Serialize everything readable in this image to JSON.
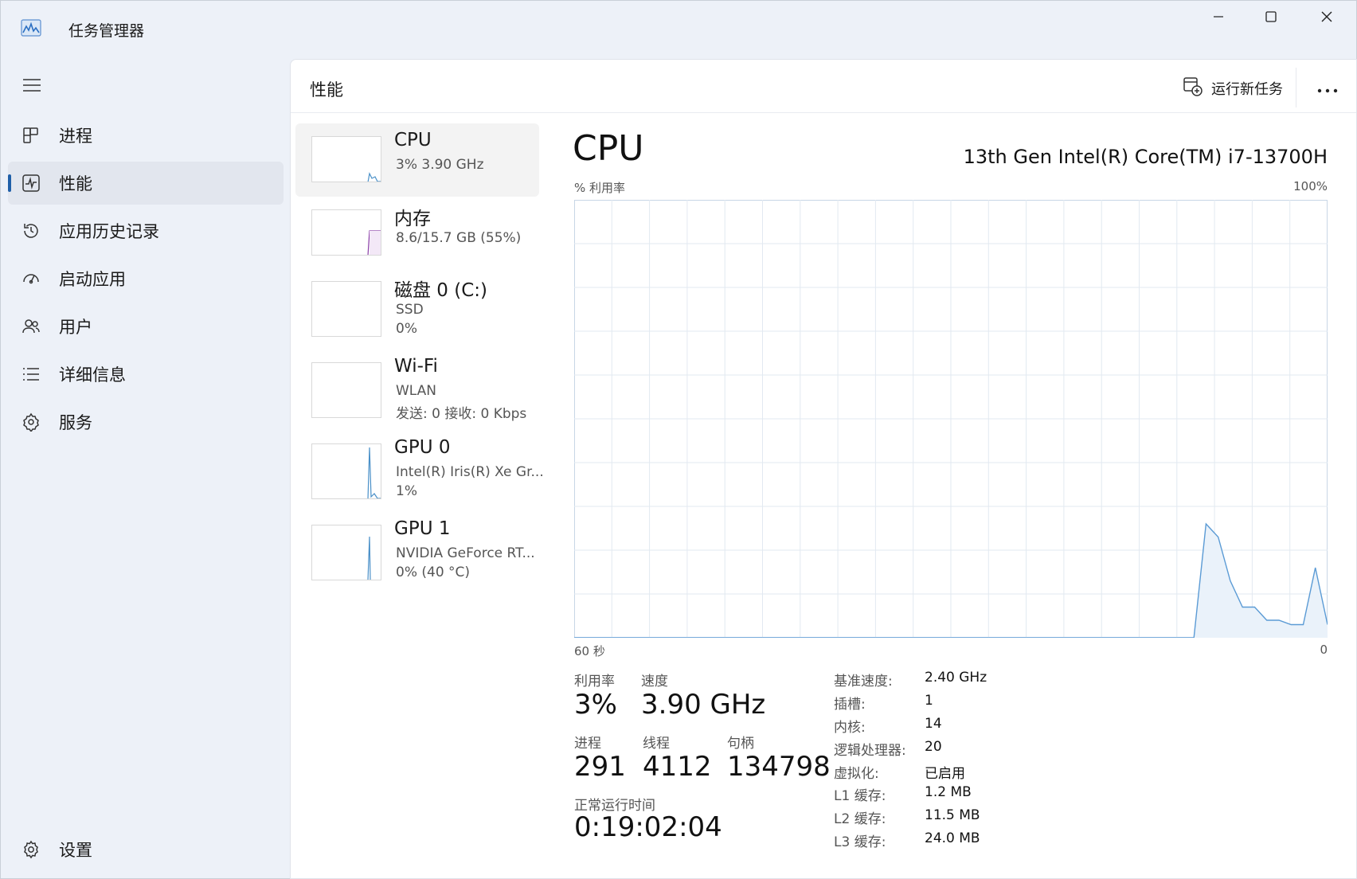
{
  "app": {
    "title": "任务管理器",
    "accent": "#1f5fa8",
    "graph_color": "#5b9bd5"
  },
  "window_controls": {
    "minimize": "minimize-icon",
    "maximize": "maximize-icon",
    "close": "close-icon"
  },
  "nav": {
    "items": [
      {
        "label": "进程",
        "icon": "processes-icon"
      },
      {
        "label": "性能",
        "icon": "performance-icon",
        "active": true
      },
      {
        "label": "应用历史记录",
        "icon": "history-icon"
      },
      {
        "label": "启动应用",
        "icon": "startup-icon"
      },
      {
        "label": "用户",
        "icon": "users-icon"
      },
      {
        "label": "详细信息",
        "icon": "details-icon"
      },
      {
        "label": "服务",
        "icon": "services-icon"
      }
    ],
    "settings_label": "设置"
  },
  "header": {
    "title": "性能",
    "run_task": "运行新任务",
    "more_icon": "more-icon"
  },
  "devices": [
    {
      "title": "CPU",
      "line1": "3%  3.90 GHz",
      "line2": ""
    },
    {
      "title": "内存",
      "line1": "8.6/15.7 GB (55%)",
      "line2": ""
    },
    {
      "title": "磁盘 0 (C:)",
      "line1": "SSD",
      "line2": "0%"
    },
    {
      "title": "Wi-Fi",
      "line1": "WLAN",
      "line2": "发送: 0  接收: 0 Kbps"
    },
    {
      "title": "GPU 0",
      "line1": "Intel(R) Iris(R) Xe Gr...",
      "line2": "1%"
    },
    {
      "title": "GPU 1",
      "line1": "NVIDIA GeForce RT...",
      "line2": "0%  (40 °C)"
    }
  ],
  "detail": {
    "title": "CPU",
    "model": "13th Gen Intel(R) Core(TM) i7-13700H",
    "y_axis_label": "% 利用率",
    "y_max": "100%",
    "x_left": "60 秒",
    "x_right": "0",
    "stats": {
      "utilization_label": "利用率",
      "utilization": "3%",
      "speed_label": "速度",
      "speed": "3.90 GHz",
      "processes_label": "进程",
      "processes": "291",
      "threads_label": "线程",
      "threads": "4112",
      "handles_label": "句柄",
      "handles": "134798",
      "uptime_label": "正常运行时间",
      "uptime": "0:19:02:04"
    },
    "info": [
      {
        "label": "基准速度:",
        "value": "2.40 GHz"
      },
      {
        "label": "插槽:",
        "value": "1"
      },
      {
        "label": "内核:",
        "value": "14"
      },
      {
        "label": "逻辑处理器:",
        "value": "20"
      },
      {
        "label": "虚拟化:",
        "value": "已启用"
      },
      {
        "label": "L1 缓存:",
        "value": "1.2 MB"
      },
      {
        "label": "L2 缓存:",
        "value": "11.5 MB"
      },
      {
        "label": "L3 缓存:",
        "value": "24.0 MB"
      }
    ]
  },
  "chart_data": {
    "type": "area",
    "x_range_seconds": [
      60,
      0
    ],
    "ylim": [
      0,
      100
    ],
    "grid": true,
    "series": [
      {
        "values": [
          0,
          0,
          0,
          0,
          0,
          0,
          0,
          0,
          0,
          0,
          0,
          0,
          0,
          0,
          0,
          0,
          0,
          0,
          0,
          0,
          0,
          0,
          0,
          0,
          0,
          0,
          0,
          0,
          0,
          0,
          0,
          0,
          0,
          0,
          0,
          0,
          0,
          0,
          0,
          0,
          0,
          0,
          0,
          0,
          0,
          0,
          0,
          0,
          0,
          0,
          0,
          0,
          26,
          23,
          13,
          7,
          7,
          4,
          4,
          3,
          3,
          16,
          3
        ]
      }
    ]
  }
}
